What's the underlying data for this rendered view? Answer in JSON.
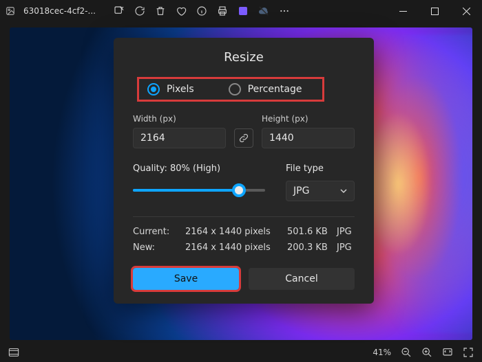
{
  "titlebar": {
    "filename": "63018cec-4cf2-..."
  },
  "dialog": {
    "title": "Resize",
    "units": {
      "pixels": "Pixels",
      "percentage": "Percentage",
      "selected": "pixels"
    },
    "width": {
      "label": "Width  (px)",
      "value": "2164"
    },
    "height": {
      "label": "Height  (px)",
      "value": "1440"
    },
    "quality": {
      "label": "Quality: 80% (High)",
      "percent": 80
    },
    "filetype": {
      "label": "File type",
      "value": "JPG"
    },
    "current": {
      "label": "Current:",
      "dimensions": "2164 x 1440 pixels",
      "size": "501.6 KB",
      "format": "JPG"
    },
    "new": {
      "label": "New:",
      "dimensions": "2164 x 1440 pixels",
      "size": "200.3 KB",
      "format": "JPG"
    },
    "buttons": {
      "save": "Save",
      "cancel": "Cancel"
    }
  },
  "statusbar": {
    "zoom": "41%"
  }
}
